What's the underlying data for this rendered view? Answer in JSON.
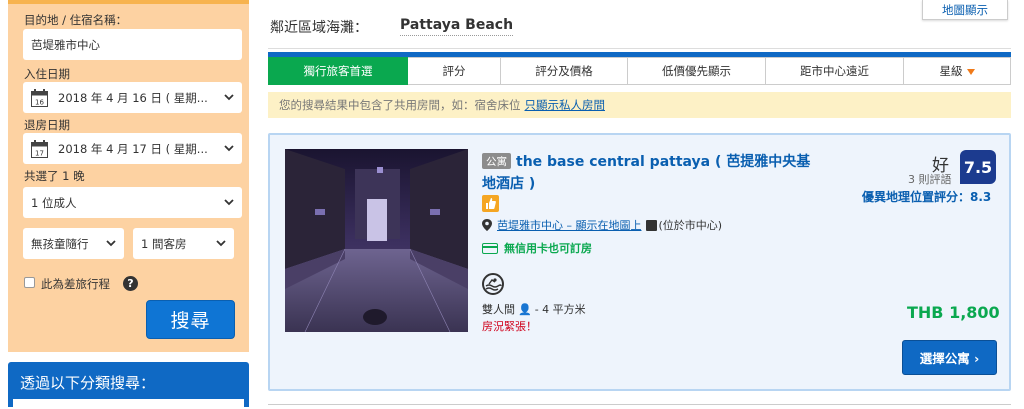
{
  "sidebar": {
    "destination_label": "目的地 / 住宿名稱：",
    "destination_value": "芭堤雅市中心",
    "checkin_label": "入住日期",
    "checkin_value": "2018 年 4 月 16 日 ( 星期...",
    "checkin_day": "16",
    "checkout_label": "退房日期",
    "checkout_value": "2018 年 4 月 17 日 ( 星期...",
    "checkout_day": "17",
    "nights": "共選了 1 晚",
    "adults_value": "1 位成人",
    "children_value": "無孩童隨行",
    "rooms_value": "1 間客房",
    "business_label": "此為差旅行程",
    "help_icon": "?",
    "search_label": "搜尋",
    "filter_title": "透過以下分類搜尋："
  },
  "main": {
    "beach_label": "鄰近區域海灘：",
    "beach_value": "Pattaya Beach",
    "map_button": "地圖顯示",
    "sort_tabs": [
      {
        "label": "獨行旅客首選"
      },
      {
        "label": "評分"
      },
      {
        "label": "評分及價格"
      },
      {
        "label": "低價優先顯示"
      },
      {
        "label": "距市中心遠近"
      },
      {
        "label": "星級"
      }
    ],
    "notice_text": "您的搜尋結果中包含了共用房間，如：宿舍床位",
    "notice_link": "只顯示私人房間"
  },
  "hotel": {
    "type_badge": "公寓",
    "name": "the base central pattaya ( 芭提雅中央基地酒店 )",
    "location_link": "芭堤雅市中心 – 顯示在地圖上",
    "location_note": "(位於市中心)",
    "card_note": "無信用卡也可訂房",
    "room_type": "雙人間",
    "room_size": "-  4 平方米",
    "urgent": "房況緊張！",
    "rating_word": "好",
    "reviews": "3 則評語",
    "score": "7.5",
    "location_score": "優異地理位置評分：8.3",
    "price": "THB 1,800",
    "select_button": "選擇公寓 ›"
  },
  "colors": {
    "sidebar_bg": "#fdd2a2",
    "primary_blue": "#0f69c4",
    "active_tab": "#0aa84f",
    "score_bg": "#1c3b8f",
    "price_green": "#0aa84f",
    "urgent_red": "#d0021b"
  }
}
